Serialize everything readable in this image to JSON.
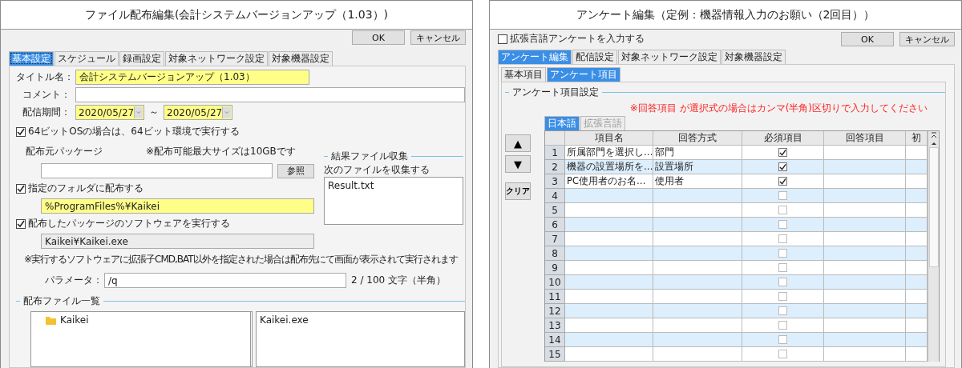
{
  "file_dialog": {
    "title": "ファイル配布編集(会計システムバージョンアップ（1.03）)",
    "buttons": [
      "OK",
      "キャンセル"
    ],
    "tabs": [
      {
        "label": "基本設定",
        "selected": true
      },
      {
        "label": "スケジュール",
        "selected": false
      },
      {
        "label": "録画設定",
        "selected": false
      },
      {
        "label": "対象ネットワーク設定",
        "selected": false
      },
      {
        "label": "対象機器設定",
        "selected": false
      }
    ],
    "title_label": "タイトル名：",
    "title_value": "会計システムバージョンアップ（1.03）",
    "comment_label": "コメント：",
    "period_label": "配信期間：",
    "period_start": "2020/05/27",
    "period_separator": "～",
    "period_end": "2020/05/27",
    "run_64bit": {
      "label": "64ビットOSの場合は、64ビット環境で実行する",
      "checked": true
    },
    "package_label": "配布元パッケージ",
    "package_note": "※配布可能最大サイズは10GBです",
    "browse_button": "参照",
    "deploy_folder": {
      "label": "指定のフォルダに配布する",
      "checked": true,
      "value": "%ProgramFiles%¥Kaikei"
    },
    "run_software": {
      "label": "配布したパッケージのソフトウェアを実行する",
      "checked": true,
      "value": "Kaikei¥Kaikei.exe"
    },
    "collect_group": {
      "title": "結果ファイル収集",
      "label": "次のファイルを収集する",
      "files": [
        "Result.txt"
      ]
    },
    "run_note": "※実行するソフトウェアに拡張子CMD,BAT以外を指定された場合は配布先にて画面が表示されて実行されます",
    "parameter_label": "パラメータ：",
    "parameter_value": "/q",
    "parameter_count": "2 /  100 文字（半角）",
    "file_list_title": "配布ファイル一覧",
    "folders": [
      "Kaikei"
    ],
    "files": [
      "Kaikei.exe"
    ]
  },
  "survey_dialog": {
    "title": "アンケート編集（定例：機器情報入力のお願い（2回目））",
    "extended_language": {
      "label": "拡張言語アンケートを入力する",
      "checked": false
    },
    "buttons": [
      "OK",
      "キャンセル"
    ],
    "tabs": [
      {
        "label": "アンケート編集",
        "selected": true
      },
      {
        "label": "配信設定",
        "selected": false
      },
      {
        "label": "対象ネットワーク設定",
        "selected": false
      },
      {
        "label": "対象機器設定",
        "selected": false
      }
    ],
    "subtabs": [
      {
        "label": "基本項目",
        "selected": false
      },
      {
        "label": "アンケート項目",
        "selected": true
      }
    ],
    "group_title": "アンケート項目設定",
    "warning": "※回答項目 が選択式の場合はカンマ(半角)区切りで入力してください",
    "language_tabs": [
      {
        "label": "日本語",
        "selected": true
      },
      {
        "label": "拡張言語",
        "selected": false
      }
    ],
    "side_buttons": [
      "▲",
      "▼",
      "クリア"
    ],
    "columns": [
      "項目名",
      "回答方式",
      "必須項目",
      "回答項目",
      "初"
    ],
    "rows": [
      {
        "number": "1",
        "name": "所属部門を選択し…",
        "answer_type": "部門",
        "required": true
      },
      {
        "number": "2",
        "name": "機器の設置場所を…",
        "answer_type": "設置場所",
        "required": true
      },
      {
        "number": "3",
        "name": "PC使用者のお名…",
        "answer_type": "使用者",
        "required": true
      },
      {
        "number": "4",
        "required": false
      },
      {
        "number": "5",
        "required": false
      },
      {
        "number": "6",
        "required": false
      },
      {
        "number": "7",
        "required": false
      },
      {
        "number": "8",
        "required": false
      },
      {
        "number": "9",
        "required": false
      },
      {
        "number": "10",
        "required": false
      },
      {
        "number": "11",
        "required": false
      },
      {
        "number": "12",
        "required": false
      },
      {
        "number": "13",
        "required": false
      },
      {
        "number": "14",
        "required": false
      },
      {
        "number": "15",
        "required": false
      }
    ]
  }
}
